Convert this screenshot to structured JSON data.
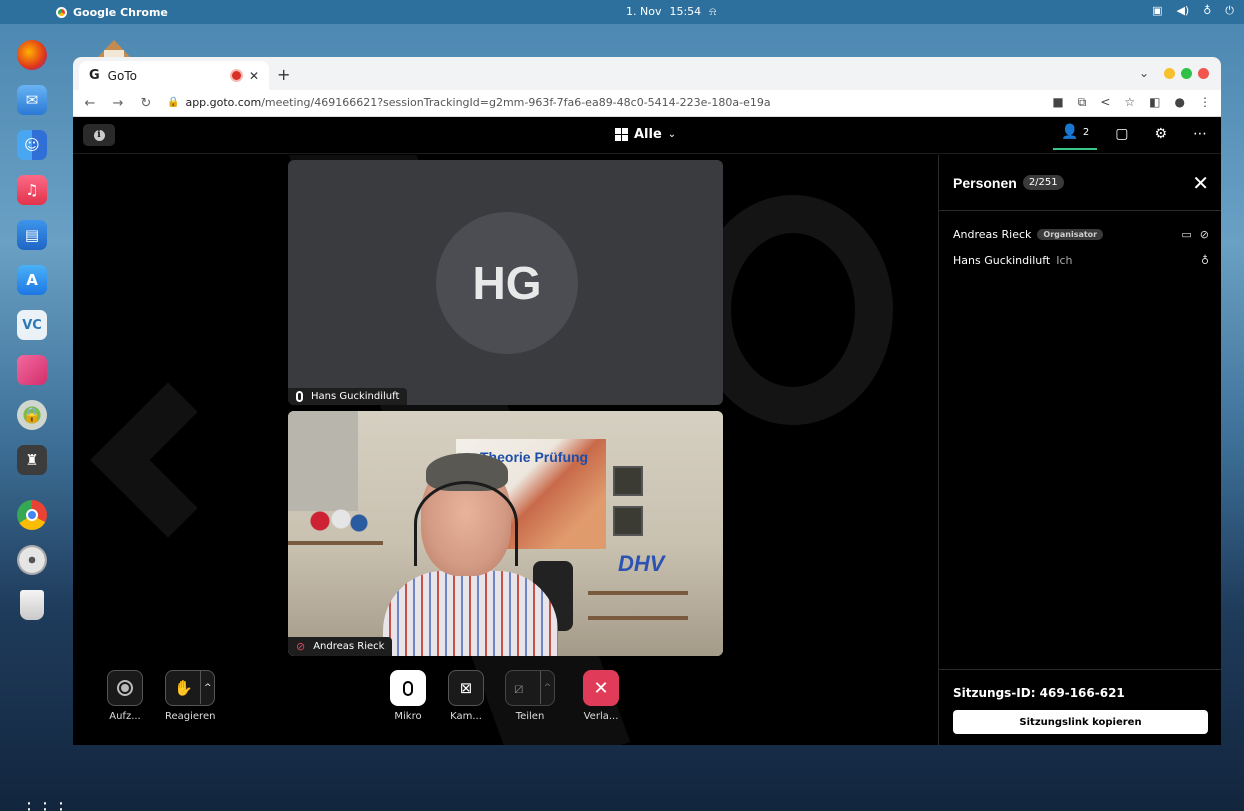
{
  "os_menu": {
    "app_name": "Google Chrome",
    "date": "1. Nov",
    "time": "15:54"
  },
  "dock": {
    "items": [
      {
        "name": "firefox-icon",
        "color": "#e66000"
      },
      {
        "name": "mail-icon",
        "color": "#3a8be0"
      },
      {
        "name": "finder-icon",
        "color": "#2f7de1"
      },
      {
        "name": "music-icon",
        "color": "#f0506e"
      },
      {
        "name": "pages-icon",
        "color": "#2a7fdb"
      },
      {
        "name": "app-store-icon",
        "color": "#2b8ff0"
      },
      {
        "name": "veracrypt-icon",
        "color": "#4aa3d8"
      },
      {
        "name": "pink-app-icon",
        "color": "#e0457b"
      },
      {
        "name": "security-agent-icon",
        "color": "#5a8a3a"
      },
      {
        "name": "keychain-icon",
        "color": "#555555"
      },
      {
        "name": "chrome-icon",
        "color": "#4285f4"
      },
      {
        "name": "dvd-player-icon",
        "color": "#9a9a9a"
      },
      {
        "name": "trash-icon",
        "color": "#cccccc"
      }
    ],
    "apps_grid": "⋮⋮⋮"
  },
  "browser": {
    "tab": {
      "favicon": "G",
      "title": "GoTo"
    },
    "url_host": "app.goto.com",
    "url_path": "/meeting/469166621?sessionTrackingId=g2mm-963f-7fa6-ea89-48c0-5414-223e-180a-e19a"
  },
  "meeting": {
    "view_selector": "Alle",
    "participant_count": "2",
    "tiles": [
      {
        "initials": "HG",
        "name": "Hans Guckindiluft"
      },
      {
        "name": "Andreas Rieck"
      }
    ],
    "projection_text": "Theorie Prüfung",
    "logo_text": "DHV",
    "controls": {
      "record": "Aufz...",
      "react": "Reagieren",
      "mic": "Mikro",
      "camera": "Kam...",
      "share": "Teilen",
      "leave": "Verla..."
    }
  },
  "panel": {
    "title": "Personen",
    "count": "2/251",
    "people": [
      {
        "name": "Andreas Rieck",
        "badge": "Organisator"
      },
      {
        "name": "Hans Guckindiluft",
        "self_label": "Ich"
      }
    ],
    "session_id_label": "Sitzungs-ID: 469-166-621",
    "copy_link_label": "Sitzungslink kopieren"
  },
  "colors": {
    "leave_red": "#e03c5a",
    "active_green": "#36c78a",
    "mute_red": "#e0475f"
  }
}
